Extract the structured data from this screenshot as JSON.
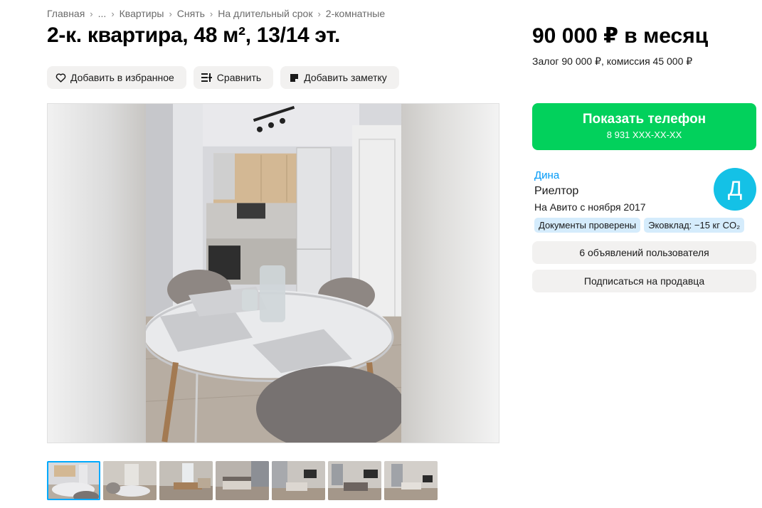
{
  "breadcrumbs": [
    "Главная",
    "...",
    "Квартиры",
    "Снять",
    "На длительный срок",
    "2-комнатные"
  ],
  "listing": {
    "title": "2-к. квартира, 48 м², 13/14 эт.",
    "price": "90 000 ₽ в месяц",
    "deposit": "Залог 90 000 ₽, комиссия 45 000 ₽"
  },
  "actions": {
    "favorite": "Добавить в избранное",
    "compare": "Сравнить",
    "note": "Добавить заметку"
  },
  "phone": {
    "label": "Показать телефон",
    "masked_number": "8 931 XXX-XX-XX"
  },
  "seller": {
    "name": "Дина",
    "role": "Риелтор",
    "since": "На Авито с ноября 2017",
    "avatar_letter": "Д",
    "avatar_color": "#14c1e6",
    "badges": [
      "Документы проверены",
      "Эковклад: −15 кг CO₂"
    ],
    "ads_button": "6 объявлений пользователя",
    "subscribe_button": "Подписаться на продавца"
  },
  "colors": {
    "accent_green": "#02d15c",
    "link_blue": "#0099f7",
    "badge_bg": "#d5ecfc"
  },
  "thumbnails_count": 7
}
